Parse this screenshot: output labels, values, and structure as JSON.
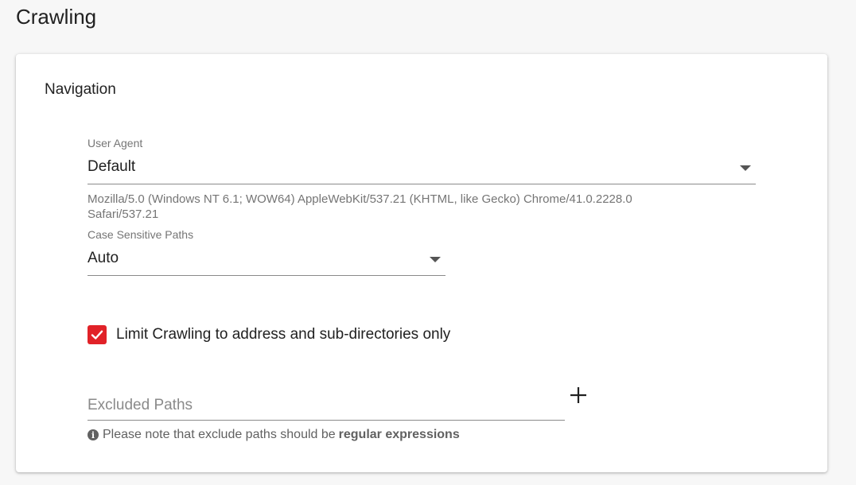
{
  "page": {
    "title": "Crawling"
  },
  "navigation": {
    "title": "Navigation",
    "user_agent": {
      "label": "User Agent",
      "value": "Default",
      "hint_line1": "Mozilla/5.0 (Windows NT 6.1; WOW64) AppleWebKit/537.21 (KHTML, like Gecko) Chrome/41.0.2228.0",
      "hint_line2": "Safari/537.21"
    },
    "case_sensitive": {
      "label": "Case Sensitive Paths",
      "value": "Auto"
    },
    "limit_crawling": {
      "label": "Limit Crawling to address and sub-directories only",
      "checked": true
    },
    "excluded_paths": {
      "placeholder": "Excluded Paths",
      "add_icon": "plus-icon",
      "note_prefix": "Please note that exclude paths should be",
      "note_emphasis": "regular expressions",
      "note_icon": "info-icon"
    }
  },
  "colors": {
    "accent": "#e12228",
    "background": "#f7f7f7",
    "card": "#ffffff"
  }
}
